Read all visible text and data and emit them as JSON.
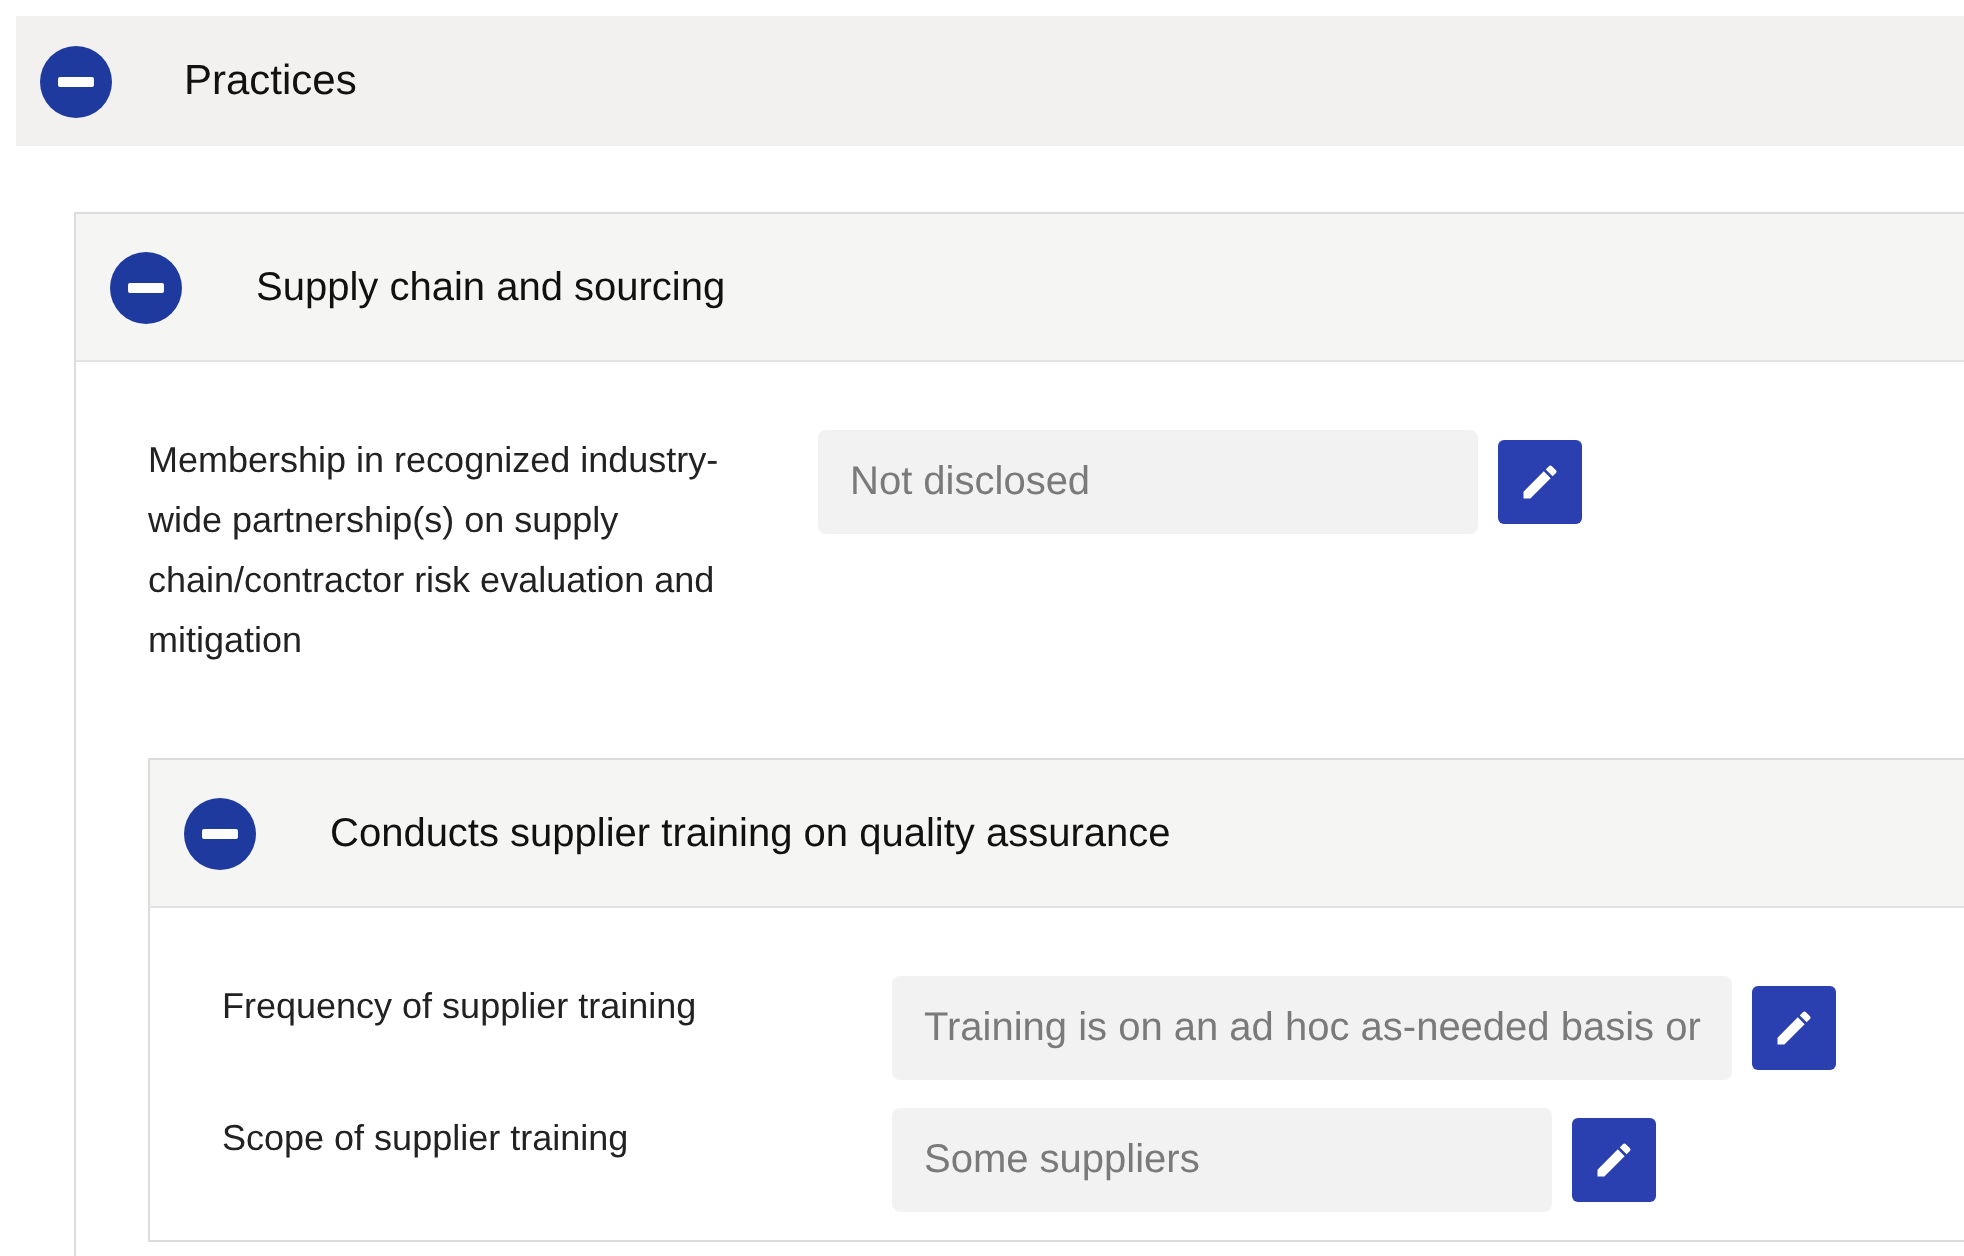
{
  "section": {
    "title": "Practices",
    "expanded": true,
    "children": [
      {
        "title": "Supply chain and sourcing",
        "expanded": true,
        "fields": [
          {
            "label": "Membership in recognized industry-wide partnership(s) on supply chain/contractor risk evaluation and mitigation",
            "value": "Not disclosed"
          }
        ],
        "children": [
          {
            "title": "Conducts supplier training on quality assurance",
            "expanded": true,
            "fields": [
              {
                "label": "Frequency of supplier training",
                "value": "Training is on an ad hoc as-needed basis or"
              },
              {
                "label": "Scope of supplier training",
                "value": "Some suppliers"
              }
            ]
          }
        ]
      }
    ]
  }
}
